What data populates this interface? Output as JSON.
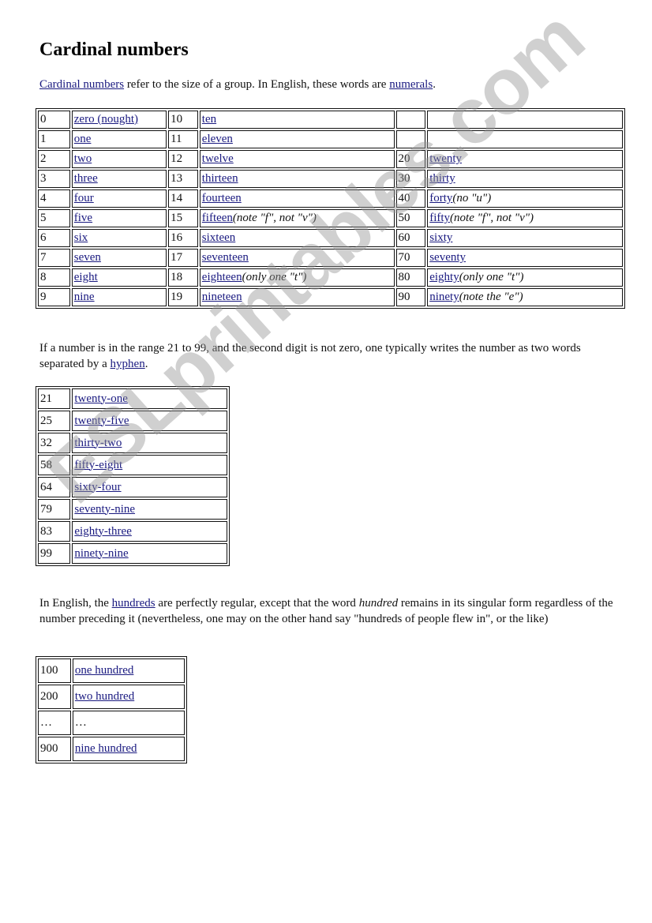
{
  "title": "Cardinal numbers",
  "intro": {
    "link1": "Cardinal numbers",
    "text1": " refer to the size of a group. In English, these words are ",
    "link2": "numerals",
    "text2": "."
  },
  "table_basic": {
    "rows": [
      {
        "n1": "0",
        "w1": "zero (nought)",
        "n2": "10",
        "w2": "ten",
        "w2_note": "",
        "n3": "",
        "w3": "",
        "w3_note": ""
      },
      {
        "n1": "1",
        "w1": "one",
        "n2": "11",
        "w2": "eleven",
        "w2_note": "",
        "n3": "",
        "w3": "",
        "w3_note": ""
      },
      {
        "n1": "2",
        "w1": "two",
        "n2": "12",
        "w2": "twelve",
        "w2_note": "",
        "n3": "20",
        "w3": "twenty",
        "w3_note": ""
      },
      {
        "n1": "3",
        "w1": "three",
        "n2": "13",
        "w2": "thirteen",
        "w2_note": "",
        "n3": "30",
        "w3": "thirty",
        "w3_note": ""
      },
      {
        "n1": "4",
        "w1": "four",
        "n2": "14",
        "w2": "fourteen",
        "w2_note": "",
        "n3": "40",
        "w3": "forty",
        "w3_note": "(no \"u\")"
      },
      {
        "n1": "5",
        "w1": "five",
        "n2": "15",
        "w2": "fifteen",
        "w2_note": "(note \"f\", not \"v\")",
        "n3": "50",
        "w3": "fifty",
        "w3_note": "(note \"f\", not \"v\")"
      },
      {
        "n1": "6",
        "w1": "six",
        "n2": "16",
        "w2": "sixteen",
        "w2_note": "",
        "n3": "60",
        "w3": "sixty",
        "w3_note": ""
      },
      {
        "n1": "7",
        "w1": "seven",
        "n2": "17",
        "w2": "seventeen",
        "w2_note": "",
        "n3": "70",
        "w3": "seventy",
        "w3_note": ""
      },
      {
        "n1": "8",
        "w1": "eight",
        "n2": "18",
        "w2": "eighteen",
        "w2_note": "(only one \"t\")",
        "n3": "80",
        "w3": "eighty",
        "w3_note": "(only one \"t\")"
      },
      {
        "n1": "9",
        "w1": "nine",
        "n2": "19",
        "w2": "nineteen",
        "w2_note": "",
        "n3": "90",
        "w3": "ninety",
        "w3_note": "(note the \"e\")"
      }
    ]
  },
  "hyphen_para": {
    "text1": "If a number is in the range 21 to 99, and the second digit is not zero, one typically writes the number as two words separated by a ",
    "link": "hyphen",
    "text2": "."
  },
  "table_compound": {
    "rows": [
      {
        "n": "21",
        "w": "twenty-one"
      },
      {
        "n": "25",
        "w": "twenty-five"
      },
      {
        "n": "32",
        "w": "thirty-two"
      },
      {
        "n": "58",
        "w": "fifty-eight"
      },
      {
        "n": "64",
        "w": "sixty-four"
      },
      {
        "n": "79",
        "w": "seventy-nine"
      },
      {
        "n": "83",
        "w": "eighty-three"
      },
      {
        "n": "99",
        "w": "ninety-nine"
      }
    ]
  },
  "hundreds_para": {
    "text1": "In English, the ",
    "link": "hundreds",
    "text2": " are perfectly regular, except that the word ",
    "emph": "hundred",
    "text3": " remains in its singular form regardless of the number preceding it (nevertheless, one may on the other hand say \"hundreds of people flew in\", or the like)"
  },
  "table_hundreds": {
    "rows": [
      {
        "n": "100",
        "w": "one hundred",
        "is_link": true
      },
      {
        "n": "200",
        "w": "two hundred",
        "is_link": true
      },
      {
        "n": "…",
        "w": "…",
        "is_link": false
      },
      {
        "n": "900",
        "w": "nine hundred",
        "is_link": true
      }
    ]
  },
  "watermark": "ESLprintables.com",
  "colors": {
    "link": "#1a1a80",
    "text": "#111111",
    "watermark": "#c8c8c8"
  }
}
